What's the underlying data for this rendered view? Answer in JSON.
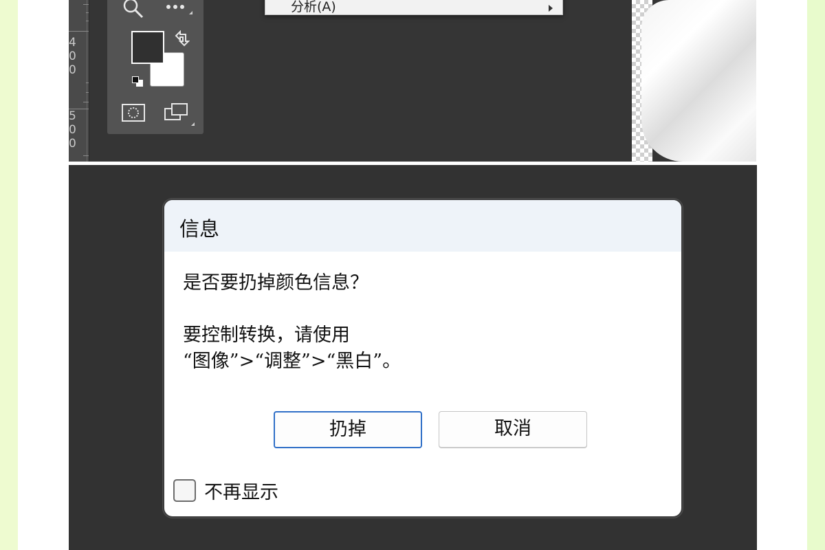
{
  "top_screenshot": {
    "ruler_numbers": [
      "4",
      "0",
      "0",
      "5",
      "0",
      "0"
    ],
    "context_menu": {
      "partial_item_label": "分析(A)",
      "has_submenu": true
    },
    "toolbox": {
      "icons": [
        "zoom-icon",
        "more-tools-icon",
        "swap-colors-icon",
        "default-colors-icon",
        "quick-mask-icon",
        "screen-mode-icon"
      ],
      "foreground_color": "#303030",
      "background_color": "#ffffff"
    }
  },
  "dialog": {
    "title": "信息",
    "message_line1": "是否要扔掉颜色信息？",
    "message_line2": "要控制转换，请使用",
    "message_line3": "“图像”>“调整”>“黑白”。",
    "discard_button": "扔掉",
    "cancel_button": "取消",
    "dont_show_again": "不再显示",
    "accent_color": "#2f6fc7"
  }
}
